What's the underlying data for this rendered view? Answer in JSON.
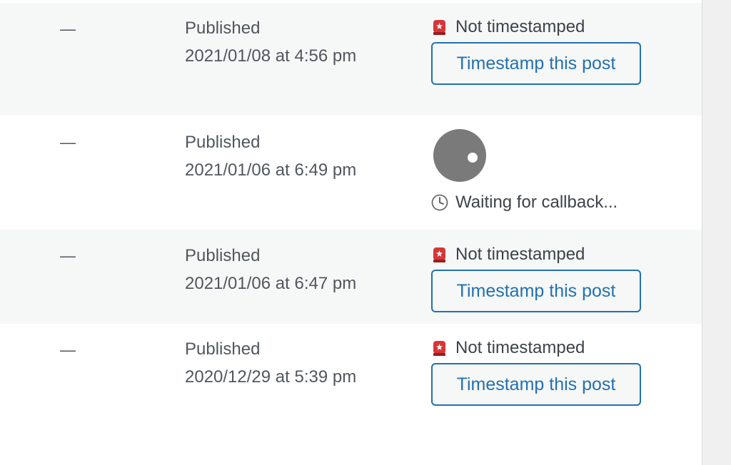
{
  "rows": [
    {
      "author_placeholder": "—",
      "status": "Published",
      "date": "2021/01/08 at 4:56 pm",
      "timestamp_status": "Not timestamped",
      "button_label": "Timestamp this post",
      "state": "not-timestamped"
    },
    {
      "author_placeholder": "—",
      "status": "Published",
      "date": "2021/01/06 at 6:49 pm",
      "timestamp_status": "Waiting for callback...",
      "state": "waiting"
    },
    {
      "author_placeholder": "—",
      "status": "Published",
      "date": "2021/01/06 at 6:47 pm",
      "timestamp_status": "Not timestamped",
      "button_label": "Timestamp this post",
      "state": "not-timestamped"
    },
    {
      "author_placeholder": "—",
      "status": "Published",
      "date": "2020/12/29 at 5:39 pm",
      "timestamp_status": "Not timestamped",
      "button_label": "Timestamp this post",
      "state": "not-timestamped"
    }
  ],
  "icons": {
    "not_timestamped": "alert-siren-icon",
    "waiting": "clock-icon",
    "loading": "spinner-icon"
  },
  "colors": {
    "button_border": "#2271b1",
    "button_text": "#2271b1",
    "alert_red": "#d63638",
    "row_alt_bg": "#f6f7f7"
  }
}
